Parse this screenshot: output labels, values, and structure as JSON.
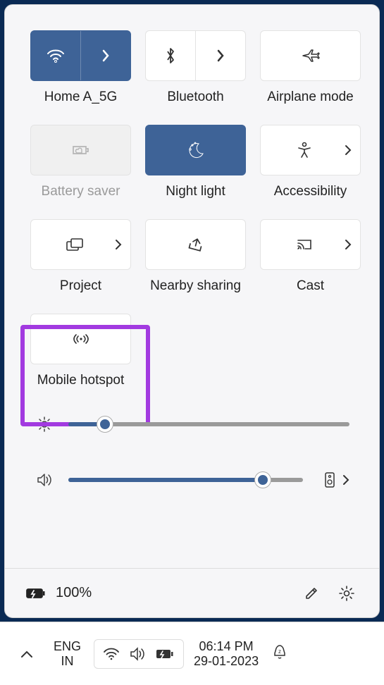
{
  "tiles": {
    "wifi": {
      "label": "Home A_5G"
    },
    "bluetooth": {
      "label": "Bluetooth"
    },
    "airplane": {
      "label": "Airplane mode"
    },
    "battery": {
      "label": "Battery saver"
    },
    "nightlight": {
      "label": "Night light"
    },
    "accessibility": {
      "label": "Accessibility"
    },
    "project": {
      "label": "Project"
    },
    "nearby": {
      "label": "Nearby sharing"
    },
    "cast": {
      "label": "Cast"
    },
    "hotspot": {
      "label": "Mobile hotspot"
    }
  },
  "sliders": {
    "brightness": {
      "value": 13
    },
    "volume": {
      "value": 83
    }
  },
  "battery": {
    "text": "100%"
  },
  "taskbar": {
    "lang1": "ENG",
    "lang2": "IN",
    "time": "06:14 PM",
    "date": "29-01-2023"
  },
  "state": {
    "wifi_active": true,
    "nightlight_active": true,
    "battery_saver_disabled": true
  },
  "colors": {
    "accent": "#3e6397",
    "highlight": "#a23ae0"
  }
}
